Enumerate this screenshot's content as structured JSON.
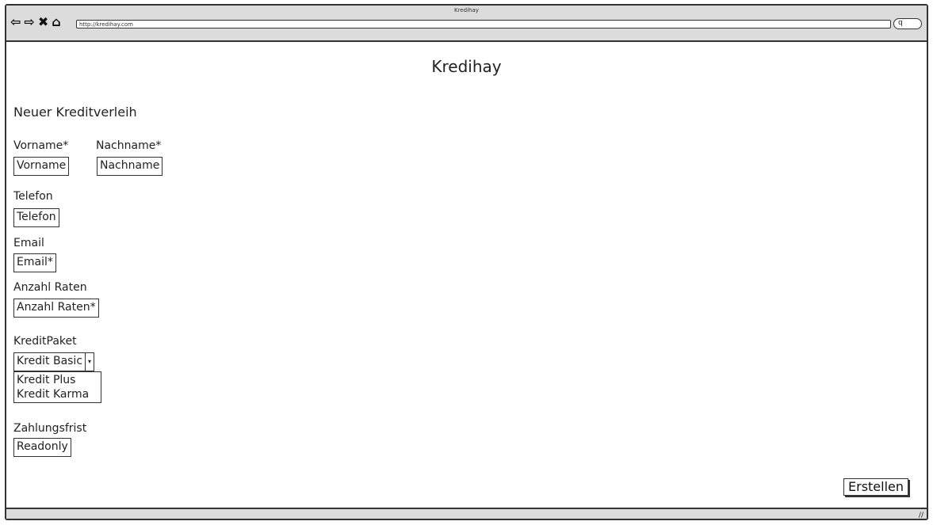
{
  "window": {
    "title": "Kredihay",
    "url": "http://kredihay.com"
  },
  "nav": {
    "back_icon": "back-arrow-icon",
    "forward_icon": "forward-arrow-icon",
    "stop_icon": "close-icon",
    "home_icon": "home-icon",
    "search_icon": "search-icon"
  },
  "page": {
    "title": "Kredihay",
    "section": "Neuer Kreditverleih"
  },
  "form": {
    "vorname": {
      "label": "Vorname*",
      "placeholder": "Vorname"
    },
    "nachname": {
      "label": "Nachname*",
      "placeholder": "Nachname"
    },
    "telefon": {
      "label": "Telefon",
      "placeholder": "Telefon"
    },
    "email": {
      "label": "Email",
      "placeholder": "Email*"
    },
    "raten": {
      "label": "Anzahl Raten",
      "placeholder": "Anzahl Raten*"
    },
    "paket": {
      "label": "KreditPaket",
      "selected": "Kredit Basic",
      "options": [
        "Kredit Plus",
        "Kredit Karma"
      ]
    },
    "frist": {
      "label": "Zahlungsfrist",
      "value": "Readonly"
    },
    "submit_label": "Erstellen"
  }
}
